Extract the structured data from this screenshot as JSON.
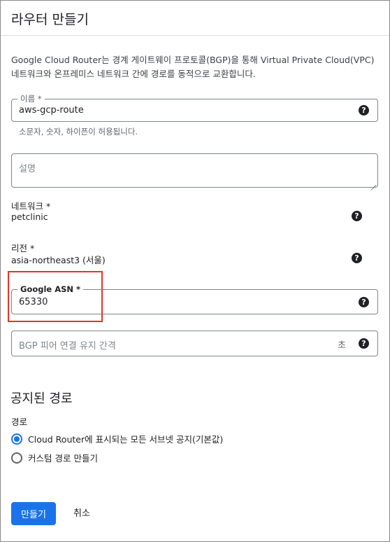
{
  "header": {
    "title": "라우터 만들기"
  },
  "description": "Google Cloud Router는 경계 게이트웨이 프로토콜(BGP)을 통해 Virtual Private Cloud(VPC) 네트워크와 온프레미스 네트워크 간에 경로를 동적으로 교환합니다.",
  "name_field": {
    "label": "이름 *",
    "value": "aws-gcp-route",
    "hint": "소문자, 숫자, 하이픈이 허용됩니다."
  },
  "description_field": {
    "placeholder": "설명"
  },
  "network": {
    "label": "네트워크 *",
    "value": "petclinic"
  },
  "region": {
    "label": "리전 *",
    "value": "asia-northeast3 (서울)"
  },
  "asn_field": {
    "label": "Google ASN *",
    "value": "65330"
  },
  "bgp_field": {
    "placeholder": "BGP 피어 연결 유지 간격",
    "unit": "초"
  },
  "advertised": {
    "title": "공지된 경로",
    "routes_label": "경로",
    "options": [
      {
        "label": "Cloud Router에 표시되는 모든 서브넷 공지(기본값)",
        "checked": true
      },
      {
        "label": "커스텀 경로 만들기",
        "checked": false
      }
    ]
  },
  "actions": {
    "create": "만들기",
    "cancel": "취소"
  },
  "icons": {
    "help": "?"
  },
  "colors": {
    "primary": "#1a73e8",
    "highlight": "#e3342f"
  }
}
